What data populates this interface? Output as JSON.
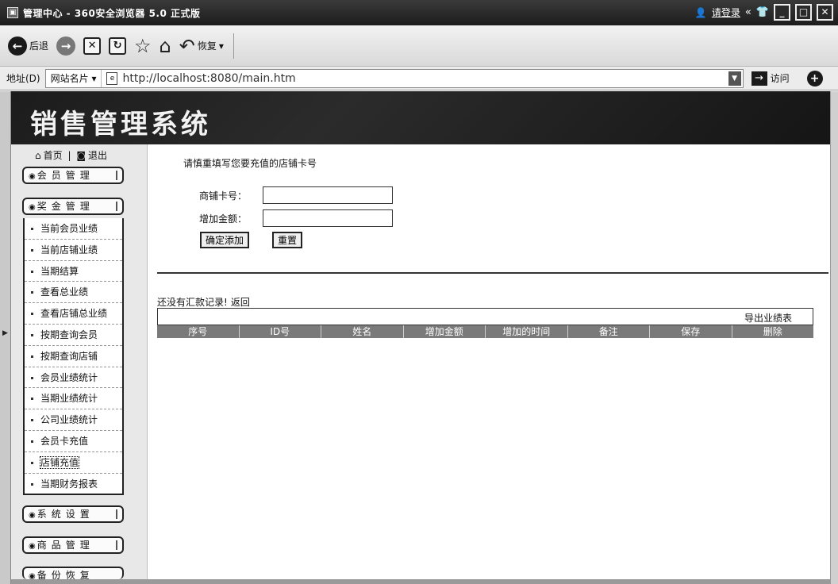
{
  "browser": {
    "title": "管理中心 - 360安全浏览器 5.0 正式版",
    "login_link": "请登录",
    "toolbar": {
      "back_label": "后退",
      "restore_label": "恢复"
    },
    "address": {
      "label": "地址(D)",
      "site_names_label": "网站名片",
      "url": "http://localhost:8080/main.htm",
      "go_label": "访问"
    }
  },
  "page": {
    "banner_title": "销售管理系统",
    "top_links": {
      "home": "首页",
      "logout": "退出",
      "separator": "|"
    },
    "sidebar": {
      "menus": [
        {
          "label": "会员管理"
        },
        {
          "label": "奖金管理"
        },
        {
          "label": "系统设置"
        },
        {
          "label": "商品管理"
        },
        {
          "label": "备份恢复"
        }
      ],
      "submenu_items": [
        {
          "label": "当前会员业绩"
        },
        {
          "label": "当前店铺业绩"
        },
        {
          "label": "当期结算"
        },
        {
          "label": "查看总业绩"
        },
        {
          "label": "查看店铺总业绩"
        },
        {
          "label": "按期查询会员"
        },
        {
          "label": "按期查询店铺"
        },
        {
          "label": "会员业绩统计"
        },
        {
          "label": "当期业绩统计"
        },
        {
          "label": "公司业绩统计"
        },
        {
          "label": "会员卡充值"
        },
        {
          "label": "店铺充值"
        },
        {
          "label": "当期财务报表"
        }
      ],
      "active_item": "店铺充值"
    },
    "form": {
      "heading": "请慎重填写您要充值的店铺卡号",
      "card_label": "商铺卡号：",
      "card_value": "",
      "amount_label": "增加金额：",
      "amount_value": "",
      "submit_label": "确定添加",
      "reset_label": "重置"
    },
    "records": {
      "empty_text": "还没有汇款记录!",
      "back_link": "返回",
      "export_link": "导出业绩表",
      "columns": [
        "序号",
        "ID号",
        "姓名",
        "增加金额",
        "增加的时间",
        "备注",
        "保存",
        "删除"
      ]
    }
  }
}
